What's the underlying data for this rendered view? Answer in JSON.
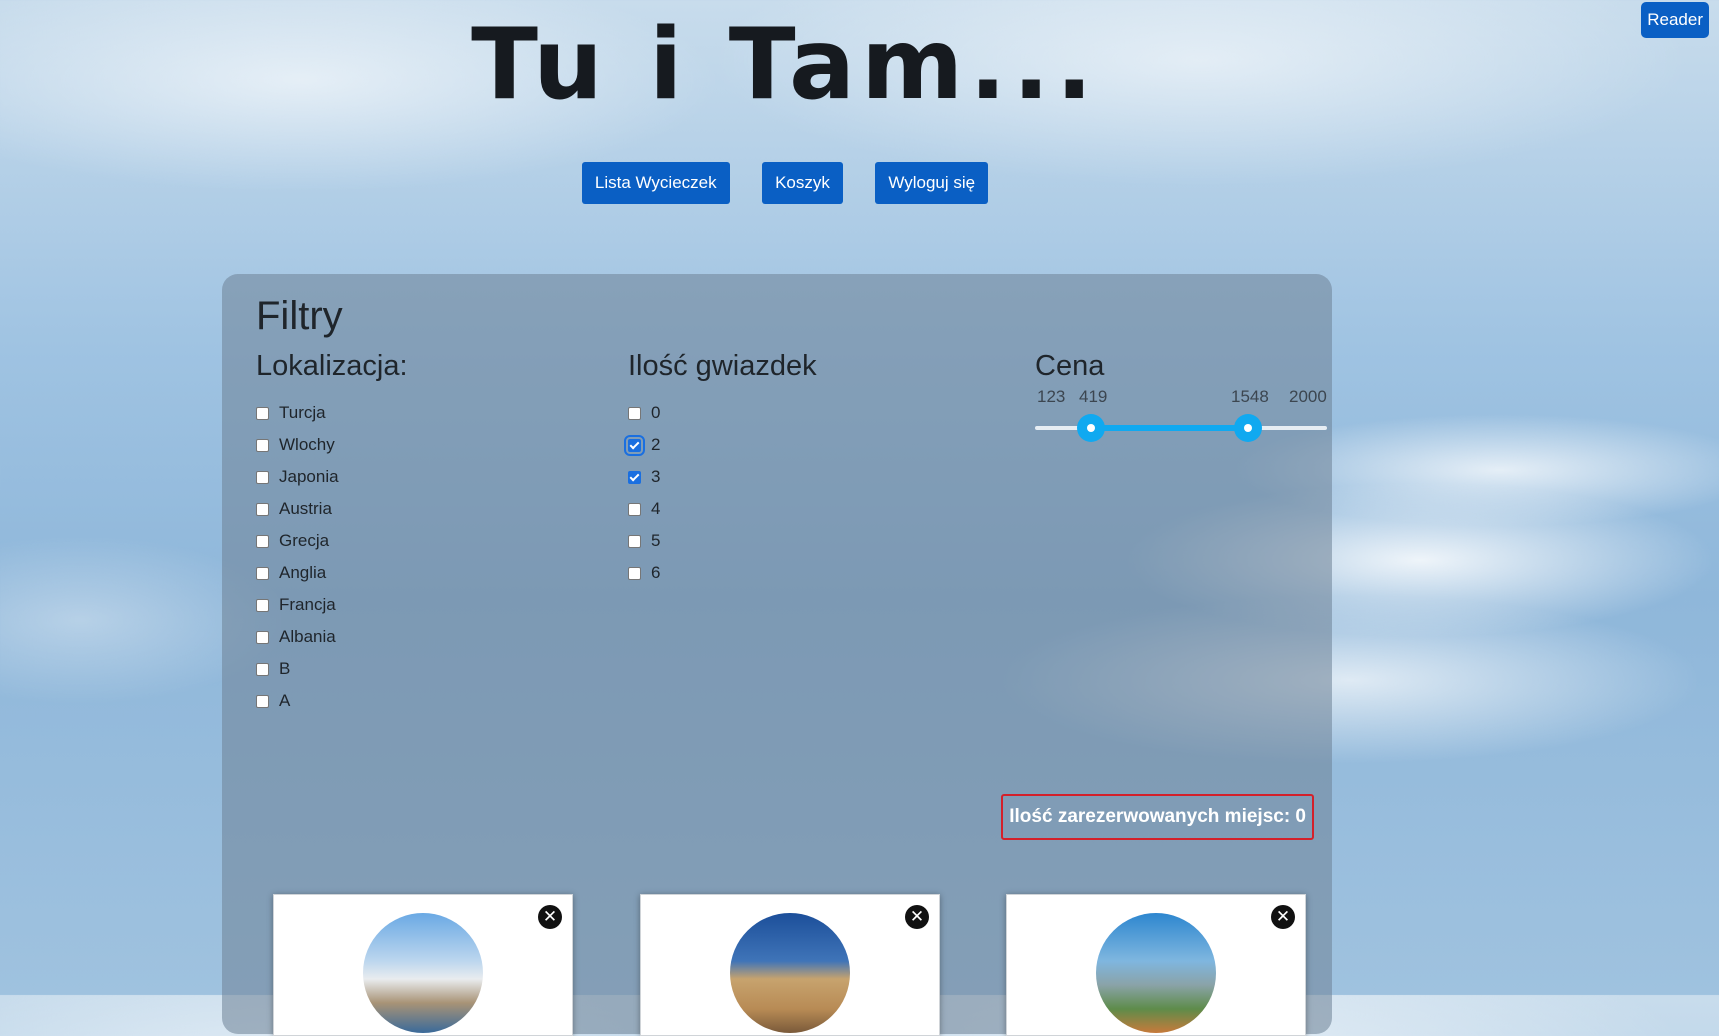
{
  "header": {
    "title": "Tu i Tam...",
    "reader_label": "Reader"
  },
  "nav": {
    "items": [
      {
        "label": "Lista Wycieczek"
      },
      {
        "label": "Koszyk"
      },
      {
        "label": "Wyloguj się"
      }
    ]
  },
  "filters": {
    "title": "Filtry",
    "location": {
      "heading": "Lokalizacja:",
      "options": [
        {
          "label": "Turcja",
          "checked": false
        },
        {
          "label": "Wlochy",
          "checked": false
        },
        {
          "label": "Japonia",
          "checked": false
        },
        {
          "label": "Austria",
          "checked": false
        },
        {
          "label": "Grecja",
          "checked": false
        },
        {
          "label": "Anglia",
          "checked": false
        },
        {
          "label": "Francja",
          "checked": false
        },
        {
          "label": "Albania",
          "checked": false
        },
        {
          "label": "B",
          "checked": false
        },
        {
          "label": "A",
          "checked": false
        }
      ]
    },
    "stars": {
      "heading": "Ilość gwiazdek",
      "options": [
        {
          "label": "0",
          "checked": false
        },
        {
          "label": "2",
          "checked": true
        },
        {
          "label": "3",
          "checked": true
        },
        {
          "label": "4",
          "checked": false
        },
        {
          "label": "5",
          "checked": false
        },
        {
          "label": "6",
          "checked": false
        }
      ]
    },
    "price": {
      "heading": "Cena",
      "min": "123",
      "low": "419",
      "high": "1548",
      "max": "2000"
    }
  },
  "reserved": {
    "label": "Ilość zarezerwowanych miejsc: 0"
  },
  "trips": {
    "cards": [
      {
        "photo": "hotel-resort-photo",
        "close_icon": "close-icon"
      },
      {
        "photo": "parthenon-photo",
        "close_icon": "close-icon"
      },
      {
        "photo": "waterpark-photo",
        "close_icon": "close-icon"
      }
    ]
  },
  "colors": {
    "primary_button": "#0a5fc4",
    "slider_accent": "#10a9f0",
    "reserved_border": "#d4202a"
  }
}
